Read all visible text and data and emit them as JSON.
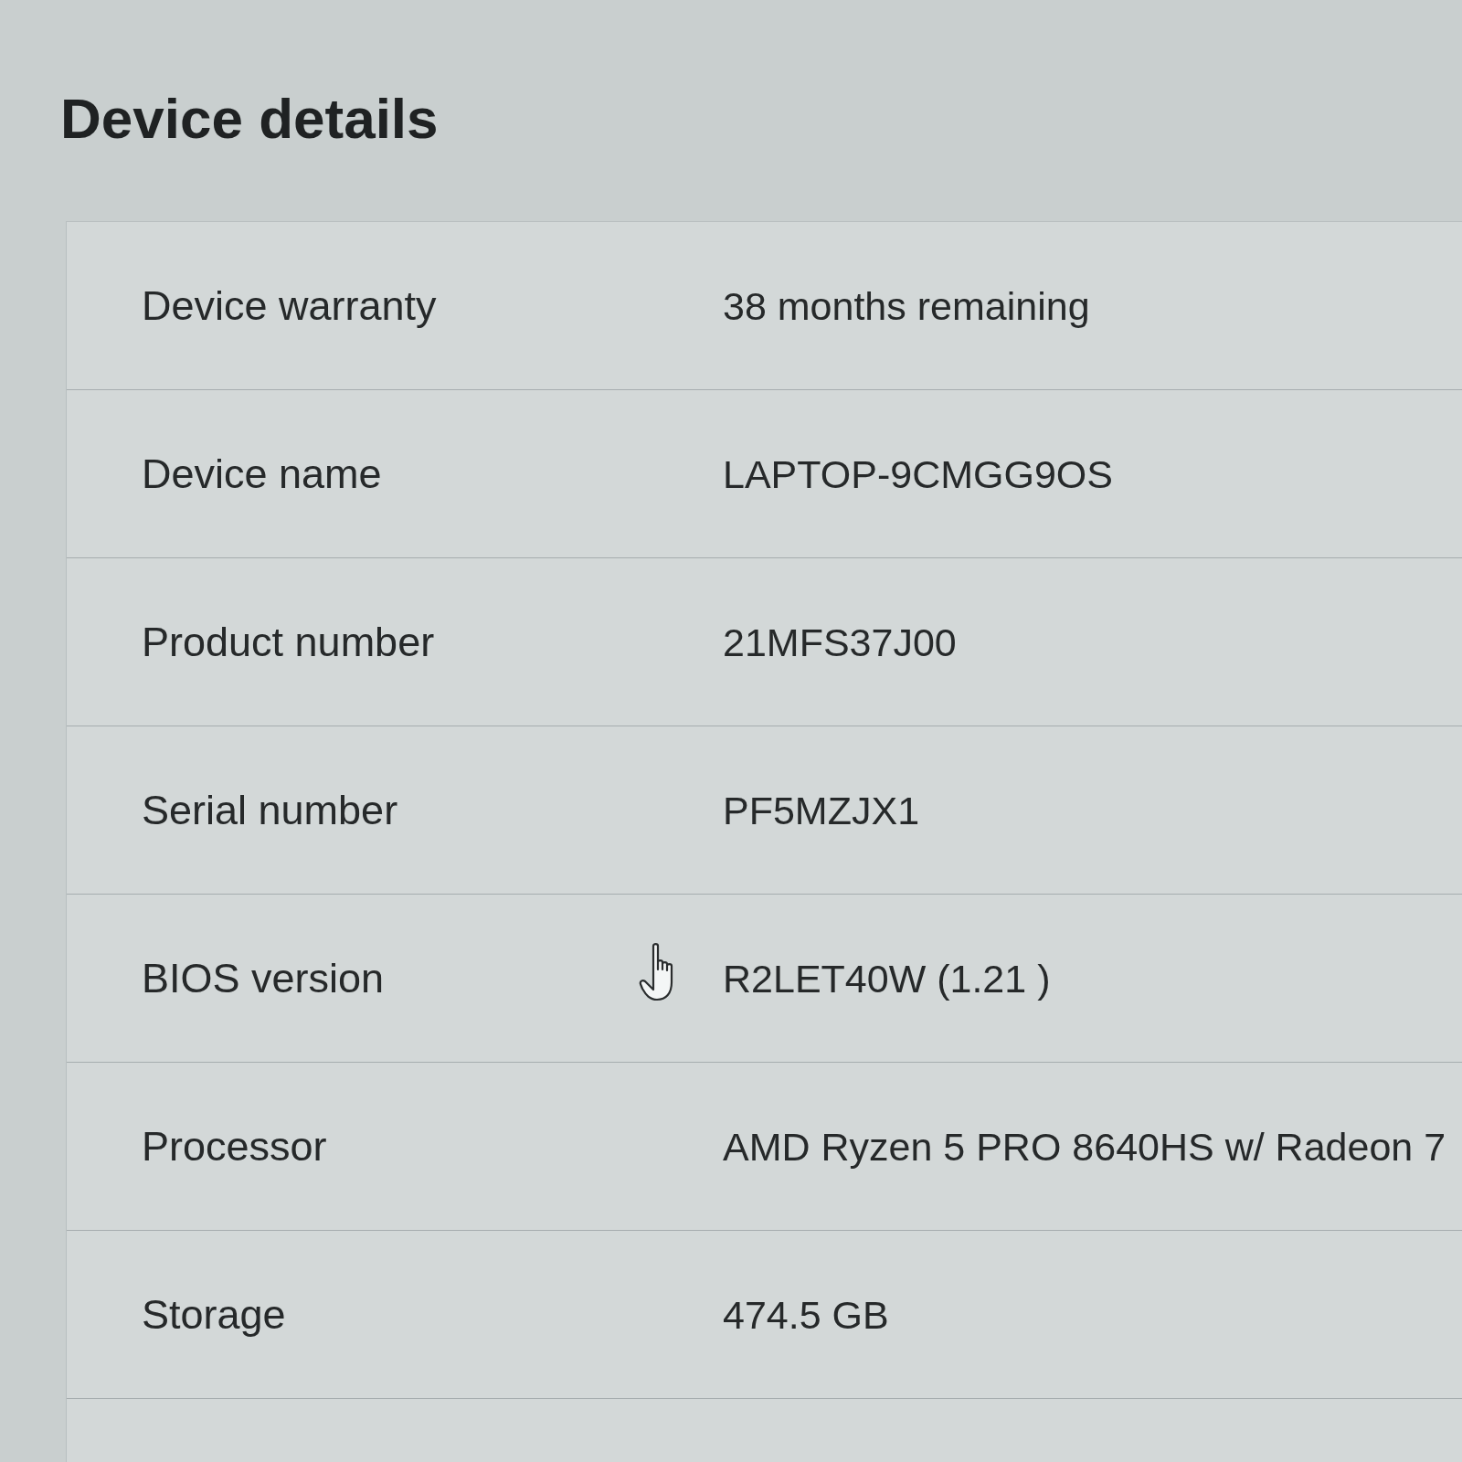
{
  "title": "Device details",
  "rows": [
    {
      "label": "Device warranty",
      "value": "38 months remaining",
      "pointer": false
    },
    {
      "label": "Device name",
      "value": "LAPTOP-9CMGG9OS",
      "pointer": false
    },
    {
      "label": "Product number",
      "value": "21MFS37J00",
      "pointer": false
    },
    {
      "label": "Serial number",
      "value": "PF5MZJX1",
      "pointer": false
    },
    {
      "label": "BIOS version",
      "value": "R2LET40W (1.21 )",
      "pointer": true
    },
    {
      "label": "Processor",
      "value": "AMD Ryzen 5 PRO 8640HS w/ Radeon 7",
      "pointer": false
    },
    {
      "label": "Storage",
      "value": "474.5 GB",
      "pointer": false
    }
  ]
}
